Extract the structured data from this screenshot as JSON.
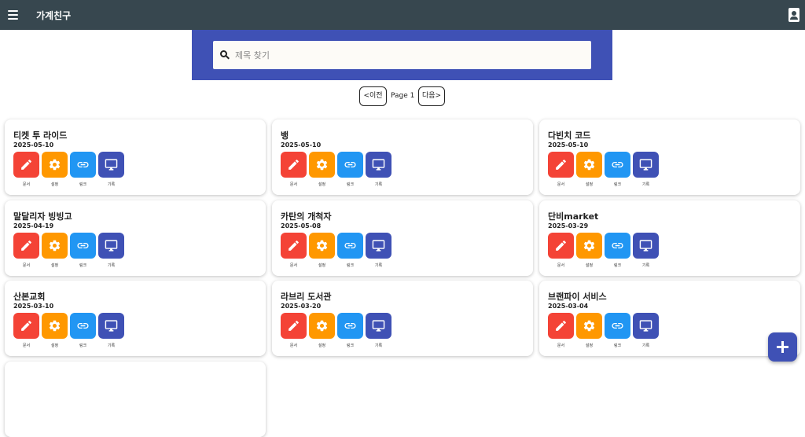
{
  "app": {
    "title": "가계친구"
  },
  "search": {
    "placeholder": "제목 찾기"
  },
  "pagination": {
    "prev": "<이전",
    "page": "Page 1",
    "next": "다음>"
  },
  "actions": {
    "doc": "문서",
    "settings": "설정",
    "link": "링크",
    "record": "기록"
  },
  "colors": {
    "topbar": "#37474f",
    "search_panel": "#3f51b5",
    "doc": "#f44336",
    "settings": "#ff9800",
    "link": "#2196f3",
    "record": "#3f51b5"
  },
  "cards": [
    {
      "title": "티켓 투 라이드",
      "date": "2025-05-10"
    },
    {
      "title": "뱅",
      "date": "2025-05-10"
    },
    {
      "title": "다빈치 코드",
      "date": "2025-05-10"
    },
    {
      "title": "말달리자 빙빙고",
      "date": "2025-04-19"
    },
    {
      "title": "카탄의 개척자",
      "date": "2025-05-08"
    },
    {
      "title": "단비market",
      "date": "2025-03-29"
    },
    {
      "title": "산본교회",
      "date": "2025-03-10"
    },
    {
      "title": "라브리 도서관",
      "date": "2025-03-20"
    },
    {
      "title": "브랜파이 서비스",
      "date": "2025-03-04"
    }
  ],
  "icons": {
    "menu": "hamburger-icon",
    "contacts": "contacts-icon",
    "search": "search-icon",
    "doc": "pencil-icon",
    "settings": "gear-icon",
    "link": "link-icon",
    "record": "monitor-icon",
    "fab": "plus-icon"
  }
}
